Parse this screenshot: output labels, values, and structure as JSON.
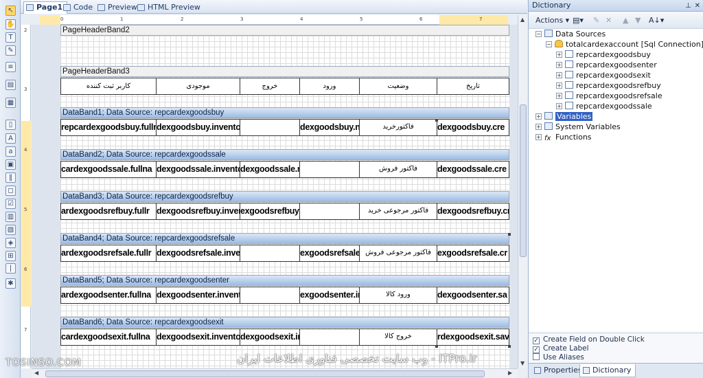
{
  "tabs": [
    {
      "label": "Page1",
      "active": true
    },
    {
      "label": "Code",
      "active": false
    },
    {
      "label": "Preview",
      "active": false
    },
    {
      "label": "HTML Preview",
      "active": false
    }
  ],
  "ruler": {
    "h_numbers": [
      "0",
      "1",
      "2",
      "3",
      "4",
      "5",
      "6",
      "7"
    ],
    "v_numbers": [
      "2",
      "3",
      "4",
      "5",
      "6",
      "7"
    ]
  },
  "bands": {
    "page_header2": "PageHeaderBand2",
    "page_header3": "PageHeaderBand3",
    "data1": "DataBand1; Data Source: repcardexgoodsbuy",
    "data2": "DataBand2; Data Source: repcardexgoodssale",
    "data3": "DataBand3; Data Source: repcardexgoodsrefbuy",
    "data4": "DataBand4; Data Source: repcardexgoodsrefsale",
    "data5": "DataBand5; Data Source: repcardexgoodsenter",
    "data6": "DataBand6; Data Source: repcardexgoodsexit"
  },
  "header_row": [
    "کاربر ثبت کننده",
    "موجودی",
    "خروج",
    "ورود",
    "وضعیت",
    "تاریخ"
  ],
  "rows": [
    [
      "repcardexgoodsbuy.fullna",
      "dexgoodsbuy.invento",
      "",
      "dexgoodsbuy.n",
      "فاکتورخرید",
      "dexgoodsbuy.cre"
    ],
    [
      "cardexgoodssale.fullna",
      "dexgoodssale.invento",
      "dexgoodssale.n",
      "",
      "فاکتور فروش",
      "dexgoodssale.cre"
    ],
    [
      "ardexgoodsrefbuy.fullr",
      "dexgoodsrefbuy.inven",
      "exgoodsrefbuy",
      "",
      "فاکتور مرجوعی خرید",
      "dexgoodsrefbuy.cr"
    ],
    [
      "ardexgoodsrefsale.fullr",
      "dexgoodsrefsale.inver",
      "",
      "exgoodsrefsale",
      "فاکتور مرجوعی فروش",
      "exgoodsrefsale.cr"
    ],
    [
      "ardexgoodsenter.fullna",
      "dexgoodsenter.invento",
      "",
      "exgoodsenter.in",
      "ورود کالا",
      "dexgoodsenter.sa"
    ],
    [
      "cardexgoodsexit.fullna",
      "dexgoodsexit.invento",
      "dexgoodsexit.in",
      "",
      "خروج کالا",
      "rdexgoodsexit.sav"
    ]
  ],
  "dictionary": {
    "title": "Dictionary",
    "toolbar": {
      "actions": "Actions"
    },
    "tree": {
      "data_sources": "Data Sources",
      "connection": "totalcardexaccount [Sql Connection]",
      "tables": [
        "repcardexgoodsbuy",
        "repcardexgoodsenter",
        "repcardexgoodsexit",
        "repcardexgoodsrefbuy",
        "repcardexgoodsrefsale",
        "repcardexgoodssale"
      ],
      "variables": "Variables",
      "system_variables": "System Variables",
      "functions": "Functions"
    },
    "options": {
      "create_field": "Create Field on Double Click",
      "create_label": "Create Label",
      "use_aliases": "Use Aliases"
    },
    "tabs": {
      "properties": "Properties",
      "dictionary": "Dictionary"
    }
  },
  "watermark": {
    "left": "TOSINSO.COM",
    "center": "ITPro.ir - وب سایت تخصصی فناوری اطلاعات ایران"
  }
}
